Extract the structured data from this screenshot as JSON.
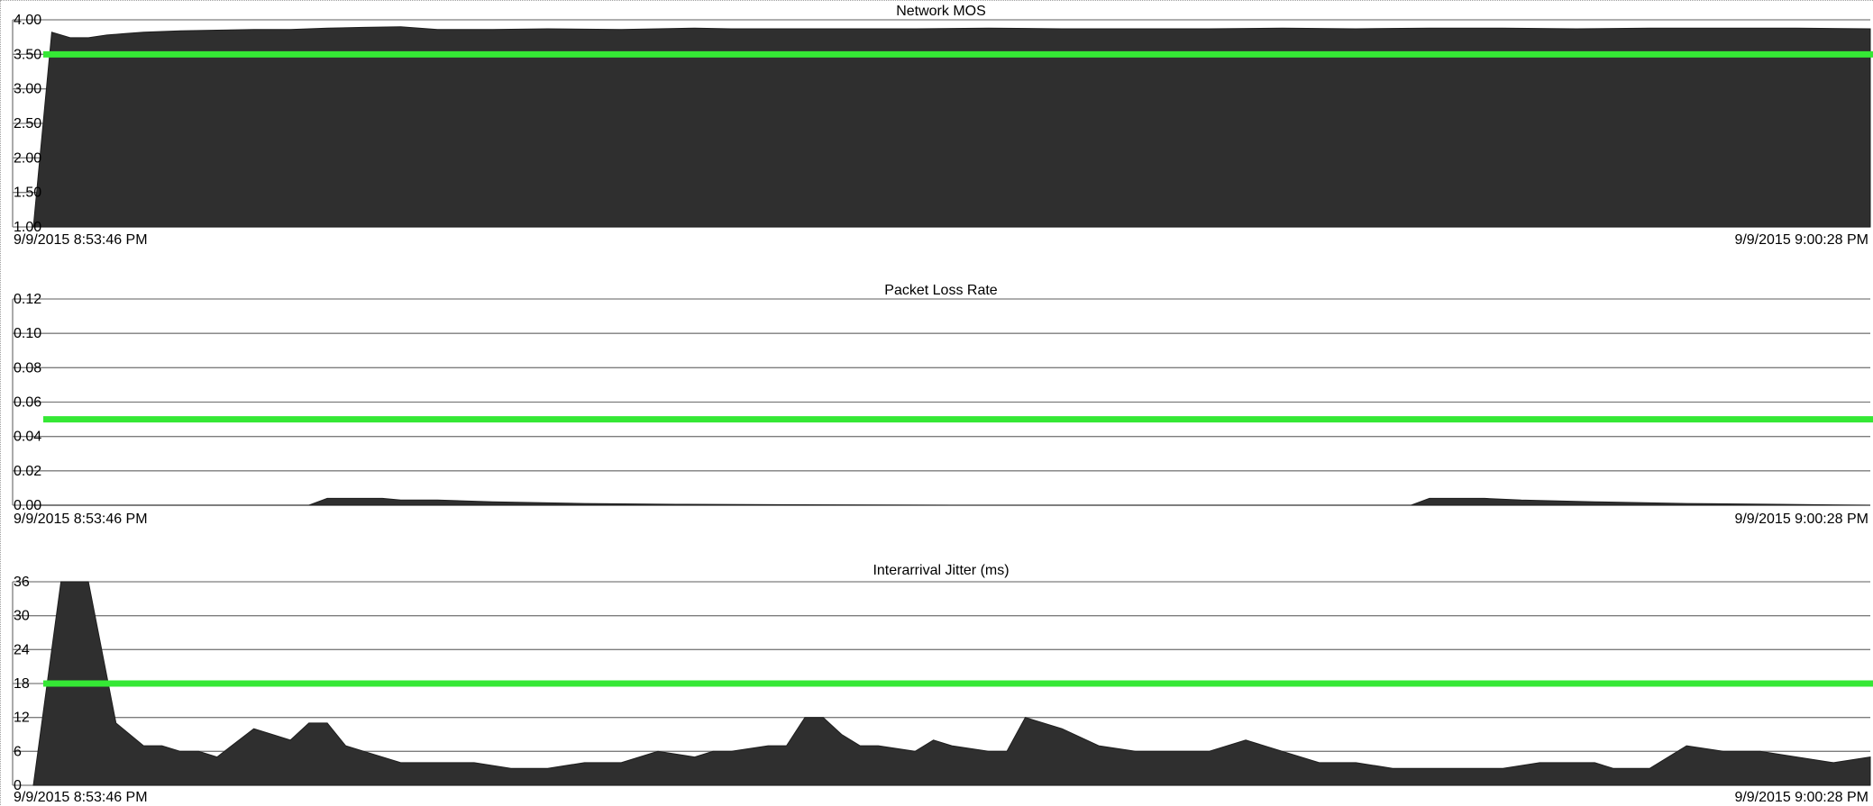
{
  "colors": {
    "area": "#2f2f2f",
    "threshold": "#35e835",
    "grid": "#7d7d7d"
  },
  "chart_data": [
    {
      "type": "area",
      "title": "Network MOS",
      "ylim": [
        1.0,
        4.0
      ],
      "yticks": [
        "1.00",
        "1.50",
        "2.00",
        "2.50",
        "3.00",
        "3.50",
        "4.00"
      ],
      "ytick_values": [
        1.0,
        1.5,
        2.0,
        2.5,
        3.0,
        3.5,
        4.0
      ],
      "x_start_label": "9/9/2015 8:53:46 PM",
      "x_end_label": "9/9/2015 9:00:28 PM",
      "grid": true,
      "threshold": 3.5,
      "x": [
        0,
        1,
        2,
        3,
        4,
        5,
        6,
        7,
        8,
        10,
        12,
        14,
        16,
        18,
        20,
        22,
        25,
        28,
        32,
        36,
        38,
        40,
        44,
        48,
        52,
        56,
        60,
        64,
        68,
        72,
        76,
        80,
        84,
        88,
        92,
        96,
        100
      ],
      "values": [
        1.0,
        3.82,
        3.74,
        3.74,
        3.78,
        3.8,
        3.82,
        3.83,
        3.84,
        3.85,
        3.86,
        3.86,
        3.88,
        3.89,
        3.9,
        3.86,
        3.86,
        3.87,
        3.86,
        3.88,
        3.87,
        3.87,
        3.87,
        3.87,
        3.88,
        3.87,
        3.87,
        3.87,
        3.88,
        3.87,
        3.88,
        3.88,
        3.87,
        3.88,
        3.88,
        3.88,
        3.87
      ]
    },
    {
      "type": "area",
      "title": "Packet Loss Rate",
      "ylim": [
        0.0,
        0.12
      ],
      "yticks": [
        "0.00",
        "0.02",
        "0.04",
        "0.06",
        "0.08",
        "0.10",
        "0.12"
      ],
      "ytick_values": [
        0.0,
        0.02,
        0.04,
        0.06,
        0.08,
        0.1,
        0.12
      ],
      "x_start_label": "9/9/2015 8:53:46 PM",
      "x_end_label": "9/9/2015 9:00:28 PM",
      "grid": true,
      "threshold": 0.05,
      "x": [
        0,
        15,
        16,
        17,
        19,
        20,
        22,
        25,
        30,
        35,
        50,
        70,
        75,
        76,
        77,
        79,
        81,
        85,
        90,
        95,
        100
      ],
      "values": [
        0.0,
        0.0,
        0.004,
        0.004,
        0.004,
        0.003,
        0.003,
        0.002,
        0.001,
        0.0005,
        0.0,
        0.0,
        0.0,
        0.004,
        0.004,
        0.004,
        0.003,
        0.002,
        0.001,
        0.0005,
        0.0
      ]
    },
    {
      "type": "area",
      "title": "Interarrival Jitter (ms)",
      "ylim": [
        0,
        36
      ],
      "yticks": [
        "0",
        "6",
        "12",
        "18",
        "24",
        "30",
        "36"
      ],
      "ytick_values": [
        0,
        6,
        12,
        18,
        24,
        30,
        36
      ],
      "x_start_label": "9/9/2015 8:53:46 PM",
      "x_end_label": "9/9/2015 9:00:28 PM",
      "grid": true,
      "threshold": 18,
      "x": [
        0,
        1.5,
        3,
        4.5,
        6,
        7,
        8,
        9,
        10,
        12,
        13,
        14,
        15,
        16,
        17,
        18,
        20,
        22,
        24,
        26,
        28,
        30,
        32,
        34,
        36,
        37,
        38,
        40,
        41,
        42,
        43,
        44,
        45,
        46,
        48,
        49,
        50,
        52,
        53,
        54,
        56,
        58,
        60,
        62,
        64,
        66,
        68,
        70,
        72,
        74,
        76,
        78,
        80,
        82,
        84,
        85,
        86,
        87,
        88,
        90,
        92,
        94,
        96,
        98,
        100
      ],
      "values": [
        0,
        36,
        36,
        11,
        7,
        7,
        6,
        6,
        5,
        10,
        9,
        8,
        11,
        11,
        7,
        6,
        4,
        4,
        4,
        3,
        3,
        4,
        4,
        6,
        5,
        6,
        6,
        7,
        7,
        12,
        12,
        9,
        7,
        7,
        6,
        8,
        7,
        6,
        6,
        12,
        10,
        7,
        6,
        6,
        6,
        8,
        6,
        4,
        4,
        3,
        3,
        3,
        3,
        4,
        4,
        4,
        3,
        3,
        3,
        7,
        6,
        6,
        5,
        4,
        5
      ]
    }
  ]
}
